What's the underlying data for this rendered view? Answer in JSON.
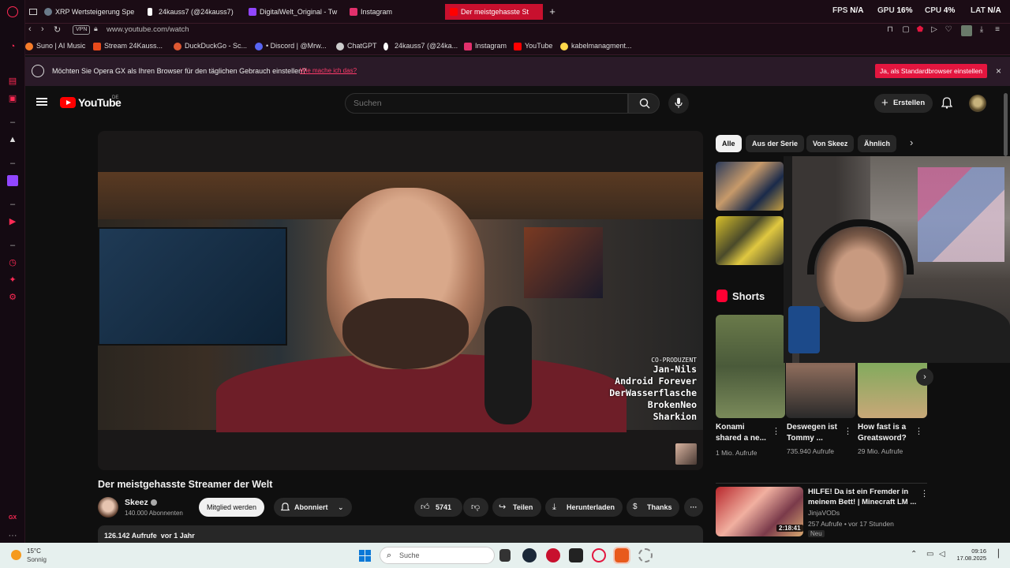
{
  "tabs": [
    {
      "label": "XRP Wertsteigerung Spe",
      "icon_color": "#6a7a8a"
    },
    {
      "label": "24kauss7 (@24kauss7) |",
      "icon": "tiktok-icon"
    },
    {
      "label": "DigitalWelt_Original - Tw",
      "icon_color": "#9146ff"
    },
    {
      "label": "Instagram",
      "icon_color": "#e1306c"
    },
    {
      "label": "Der meistgehasste St",
      "active": true
    }
  ],
  "system_stats": {
    "fps_label": "FPS",
    "fps": "N/A",
    "gpu_label": "GPU",
    "gpu": "16%",
    "cpu_label": "CPU",
    "cpu": "4%",
    "lat_label": "LAT",
    "lat": "N/A"
  },
  "address": {
    "vpn": "VPN",
    "url": "www.youtube.com/watch"
  },
  "bookmarks": [
    {
      "label": "Suno | AI Music",
      "color": "#f57c2a"
    },
    {
      "label": "Stream 24Kauss...",
      "color": "#e84a1c"
    },
    {
      "label": "DuckDuckGo - Sc...",
      "color": "#de5833"
    },
    {
      "label": "• Discord | @Mrw...",
      "color": "#5865f2"
    },
    {
      "label": "ChatGPT",
      "color": "#cccccc"
    },
    {
      "label": "24kauss7 (@24ka...",
      "color": "#ffffff"
    },
    {
      "label": "Instagram",
      "color": "#e1306c"
    },
    {
      "label": "YouTube",
      "color": "#ff0000"
    },
    {
      "label": "kabelmanagment...",
      "color": "#ffd84a"
    }
  ],
  "banner": {
    "text": "Möchten Sie Opera GX als Ihren Browser für den täglichen Gebrauch einstellen?",
    "link": "Wie mache ich das?",
    "button": "Ja, als Standardbrowser einstellen",
    "close": "×"
  },
  "youtube": {
    "logo_text": "YouTube",
    "region": "DE",
    "search_placeholder": "Suchen",
    "create_label": "Erstellen",
    "video": {
      "credits_title": "CO-PRODUZENT",
      "credits": [
        "Jan-Nils",
        "Android Forever",
        "DerWasserflasche",
        "BrokenNeo",
        "Sharkion"
      ],
      "title": "Der meistgehasste Streamer der Welt",
      "channel": "Skeez",
      "subscribers": "140.000 Abonnenten",
      "join_label": "Mitglied werden",
      "subscribed_label": "Abonniert",
      "likes": "5741",
      "share_label": "Teilen",
      "download_label": "Herunterladen",
      "thanks_label": "Thanks",
      "more_label": "···",
      "views": "126.142 Aufrufe",
      "age": "vor 1 Jahr"
    },
    "chips": [
      "Alle",
      "Aus der Serie",
      "Von Skeez",
      "Ähnlich"
    ],
    "shorts_title": "Shorts",
    "shorts": [
      {
        "title": "Konami shared a ne...",
        "views": "1 Mio. Aufrufe"
      },
      {
        "title": "Deswegen ist Tommy ...",
        "views": "735.940 Aufrufe"
      },
      {
        "title": "How fast is a Greatsword?",
        "views": "29 Mio. Aufrufe"
      }
    ],
    "recommended": {
      "title": "HILFE! Da ist ein Fremder in meinem Bett! | Minecraft LM ...",
      "channel": "JinjaVODs",
      "meta": "257 Aufrufe • vor 17 Stunden",
      "badge": "Neu",
      "duration": "2:18:41"
    }
  },
  "taskbar": {
    "temperature": "15°C",
    "weather": "Sonnig",
    "search_placeholder": "Suche",
    "time": "09:16",
    "date": "17.08.2025"
  }
}
